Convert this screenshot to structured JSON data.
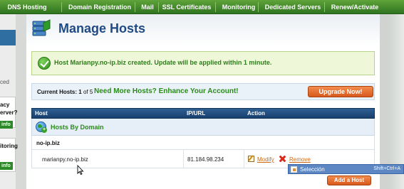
{
  "nav": {
    "items": [
      "DNS Hosting",
      "Domain Registration",
      "Mail",
      "SSL Certificates",
      "Monitoring",
      "Dedicated Servers",
      "Renew/Activate"
    ]
  },
  "sidebar": {
    "texts": [
      "ced",
      "acy",
      "erver?",
      "itoring"
    ],
    "buttons": [
      "info",
      "info"
    ]
  },
  "page": {
    "title": "Manage Hosts"
  },
  "success": {
    "message": "Host Marianpy.no-ip.biz created. Update will be applied within 1 minute."
  },
  "current": {
    "label": "Current Hosts:",
    "count": "1",
    "of_text": "of",
    "max": "5",
    "promo": "Need More Hosts? Enhance Your Account!",
    "upgrade_label": "Upgrade Now!"
  },
  "table": {
    "headers": [
      "Host",
      "IP/URL",
      "Action"
    ],
    "group_label": "Hosts By Domain",
    "domain": "no-ip.biz",
    "rows": [
      {
        "host": "marianpy.no-ip.biz",
        "ip": "81.184.98.234",
        "modify": "Modify",
        "remove": "Remove"
      }
    ]
  },
  "add_host_label": "Add a Host",
  "context_menu": {
    "label": "Selección",
    "shortcut": "Shift+Ctrl+A"
  },
  "colors": {
    "nav_green": "#2f7420",
    "title_blue": "#1f4a84",
    "success_green": "#2e7d1a",
    "header_blue": "#173f6e",
    "orange": "#d8581c"
  }
}
